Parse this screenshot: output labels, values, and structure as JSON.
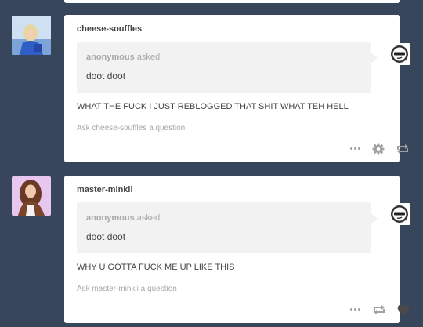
{
  "posts": [
    {
      "username": "cheese-souffles",
      "asker": "anonymous",
      "asked_label": "asked:",
      "question": "doot doot",
      "answer": "WHAT THE FUCK I JUST REBLOGGED THAT SHIT WHAT TEH HELL",
      "ask_link": "Ask cheese-souffles a question",
      "controls": [
        "more-icon",
        "settings-icon",
        "reblog-icon"
      ]
    },
    {
      "username": "master-minkii",
      "asker": "anonymous",
      "asked_label": "asked:",
      "question": "doot doot",
      "answer": "WHY U GOTTA FUCK ME UP LIKE THIS",
      "ask_link": "Ask master-minkii a question",
      "controls": [
        "more-icon",
        "reblog-icon",
        "like-icon"
      ]
    }
  ],
  "colors": {
    "background": "#37465a",
    "card": "#ffffff",
    "ask_box": "#f2f2f2",
    "text": "#444444",
    "muted": "#a8a8a8"
  }
}
